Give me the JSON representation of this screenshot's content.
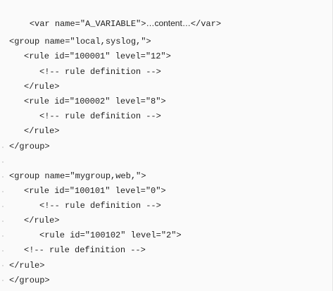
{
  "code": {
    "lines": [
      {
        "text": "<var name=\"A_VARIABLE\">"
      },
      {
        "text": "<group name=\"local,syslog,\">"
      },
      {
        "text": "<rule id=\"100001\" level=\"12\">"
      },
      {
        "text": "<!-- rule definition -->"
      },
      {
        "text": "</rule>"
      },
      {
        "text": "<rule id=\"100002\" level=\"8\">"
      },
      {
        "text": "<!-- rule definition -->"
      },
      {
        "text": "</rule>"
      },
      {
        "text": "</group>"
      },
      {
        "text": "<group name=\"mygroup,web,\">"
      },
      {
        "text": "<rule id=\"100101\" level=\"0\">"
      },
      {
        "text": "<!-- rule definition -->"
      },
      {
        "text": "</rule>"
      },
      {
        "text": "<rule id=\"100102\" level=\"2\">"
      },
      {
        "text": "<!-- rule definition -->"
      },
      {
        "text": "</rule>"
      },
      {
        "text": "</group>"
      }
    ],
    "line1_content": "…content…",
    "line1_close": "</var>"
  }
}
